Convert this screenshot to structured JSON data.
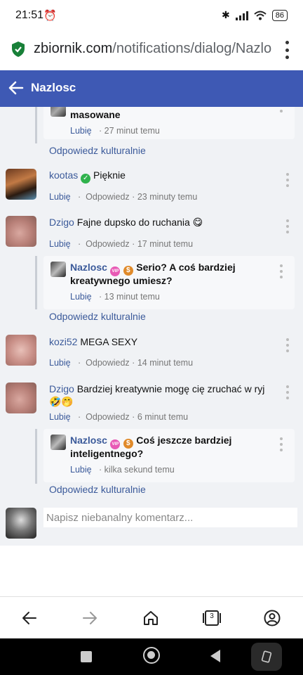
{
  "status_bar": {
    "time": "21:51",
    "battery": "86"
  },
  "browser": {
    "url_domain": "zbiornik.com",
    "url_path": "/notifications/dialog/Nazlo",
    "tab_count": "3"
  },
  "header": {
    "title": "Nazlosc"
  },
  "thread": {
    "top_reply": {
      "text": "masowane",
      "like": "Lubię",
      "time": "27 minut temu",
      "reply_link": "Odpowiedz kulturalnie"
    },
    "comments": [
      {
        "author": "kootas",
        "text": "Pięknie",
        "like": "Lubię",
        "reply": "Odpowiedz",
        "time": "23 minuty temu"
      },
      {
        "author": "Dzigo",
        "text": "Fajne dupsko do ruchania 😋",
        "like": "Lubię",
        "reply": "Odpowiedz",
        "time": "17 minut temu",
        "reply_item": {
          "author": "Nazlosc",
          "text_line1": "Serio? A coś bardziej",
          "text_line2": "kreatywnego umiesz?",
          "like": "Lubię",
          "time": "13 minut temu"
        },
        "reply_link": "Odpowiedz kulturalnie"
      },
      {
        "author": "kozi52",
        "text": "MEGA SEXY",
        "like": "Lubię",
        "reply": "Odpowiedz",
        "time": "14 minut temu"
      },
      {
        "author": "Dzigo",
        "text_line1": "Bardziej kreatywnie mogę cię zruchać w ryj",
        "text_line2": "🤣🤭",
        "like": "Lubię",
        "reply": "Odpowiedz",
        "time": "6 minut temu",
        "reply_item": {
          "author": "Nazlosc",
          "text_line1": "Coś jeszcze bardziej",
          "text_line2": "inteligentnego?",
          "like": "Lubię",
          "time": "kilka sekund temu"
        },
        "reply_link": "Odpowiedz kulturalnie"
      }
    ],
    "separator": "·"
  },
  "composer": {
    "placeholder": "Napisz niebanalny komentarz..."
  },
  "colors": {
    "header_bg": "#3e59b4",
    "link": "#3b5a9a",
    "verified": "#2fb24c",
    "vip": "#e85ab5",
    "coin": "#e08a2a"
  }
}
